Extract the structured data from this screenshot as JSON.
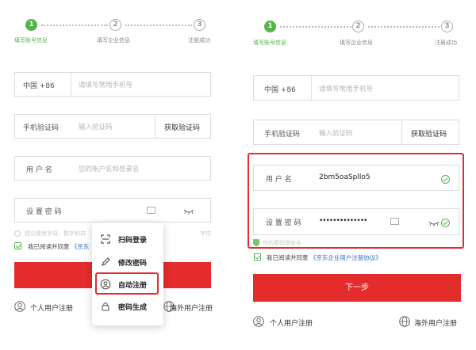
{
  "steps": [
    {
      "num": "1",
      "label": "填写账号信息"
    },
    {
      "num": "2",
      "label": "填写企业信息"
    },
    {
      "num": "3",
      "label": "注册成功"
    }
  ],
  "phone": {
    "country": "中国 +86",
    "placeholder": "请填写常用手机号"
  },
  "sms": {
    "label": "手机验证码",
    "placeholder": "输入验证码",
    "button": "获取验证码"
  },
  "username": {
    "label": "用 户 名",
    "placeholder": "您的账户名和登录名",
    "value": "2bm5oaSpllo5"
  },
  "password": {
    "label": "设 置 密 码",
    "value": "••••••••••••••"
  },
  "hint_left_a": "建议使用字母、数字和符",
  "hint_left_b": "字符",
  "strength_hint": "你的密码很安全",
  "agree": {
    "prefix": "我已阅读并同意",
    "link_short": "《京东",
    "link_full": "《京东企业用户注册协议》"
  },
  "next_button": "下一步",
  "footer": {
    "personal": "个人用户注册",
    "overseas": "海外用户注册"
  },
  "menu": [
    {
      "icon": "scan-icon",
      "label": "扫码登录"
    },
    {
      "icon": "pencil-icon",
      "label": "修改密码"
    },
    {
      "icon": "user-circle-icon",
      "label": "自动注册"
    },
    {
      "icon": "lock-icon",
      "label": "密码生成"
    }
  ],
  "colors": {
    "accent_green": "#54b34a",
    "accent_red": "#e42c2d",
    "link_blue": "#2c6fb8"
  }
}
